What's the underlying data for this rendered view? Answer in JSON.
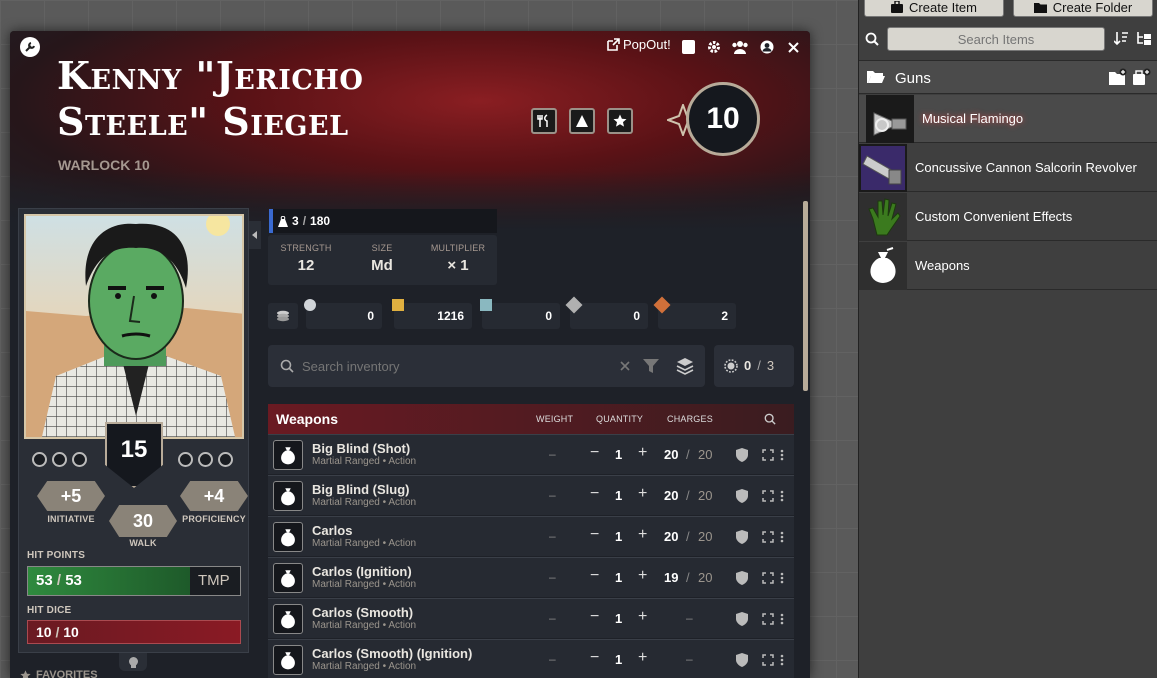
{
  "sheet": {
    "popout_label": "PopOut!",
    "character_name": "Kenny \"Jericho Steele\" Siegel",
    "class_level": "WARLOCK 10",
    "level": "10",
    "armor_class": "15",
    "initiative": {
      "value": "+5",
      "label": "INITIATIVE"
    },
    "proficiency": {
      "value": "+4",
      "label": "PROFICIENCY"
    },
    "walk": {
      "value": "30",
      "label": "WALK"
    },
    "hit_points": {
      "label": "HIT POINTS",
      "current": "53",
      "max": "53",
      "temp_label": "TMP"
    },
    "hit_dice": {
      "label": "HIT DICE",
      "current": "10",
      "max": "10"
    },
    "favorites_label": "FAVORITES",
    "encumbrance": {
      "current": "3",
      "max": "180",
      "fraction": 0.017
    },
    "stats": [
      {
        "label": "STRENGTH",
        "value": "12"
      },
      {
        "label": "SIZE",
        "value": "Md"
      },
      {
        "label": "MULTIPLIER",
        "value": "× 1"
      }
    ],
    "currency": [
      "0",
      "1216",
      "0",
      "0",
      "2"
    ],
    "search_placeholder": "Search inventory",
    "attunement": {
      "current": "0",
      "max": "3"
    },
    "weapons_header": {
      "title": "Weapons",
      "weight": "WEIGHT",
      "quantity": "QUANTITY",
      "charges": "CHARGES"
    },
    "weapons": [
      {
        "name": "Big Blind (Shot)",
        "sub": "Martial Ranged • Action",
        "weight": "–",
        "qty": "1",
        "charges": "20",
        "max": "20"
      },
      {
        "name": "Big Blind (Slug)",
        "sub": "Martial Ranged • Action",
        "weight": "–",
        "qty": "1",
        "charges": "20",
        "max": "20"
      },
      {
        "name": "Carlos",
        "sub": "Martial Ranged • Action",
        "weight": "–",
        "qty": "1",
        "charges": "20",
        "max": "20"
      },
      {
        "name": "Carlos (Ignition)",
        "sub": "Martial Ranged • Action",
        "weight": "–",
        "qty": "1",
        "charges": "19",
        "max": "20"
      },
      {
        "name": "Carlos (Smooth)",
        "sub": "Martial Ranged • Action",
        "weight": "–",
        "qty": "1",
        "charges": "–",
        "max": ""
      },
      {
        "name": "Carlos (Smooth) (Ignition)",
        "sub": "Martial Ranged • Action",
        "weight": "–",
        "qty": "1",
        "charges": "–",
        "max": ""
      }
    ]
  },
  "items_panel": {
    "create_item": "Create Item",
    "create_folder": "Create Folder",
    "search_placeholder": "Search Items",
    "folder": "Guns",
    "items": [
      {
        "name": "Musical Flamingo",
        "icon": "trumpet-icon"
      },
      {
        "name": "Concussive Cannon Salcorin Revolver",
        "icon": "cannon-icon"
      },
      {
        "name": "Custom Convenient Effects",
        "icon": "hand-icon"
      },
      {
        "name": "Weapons",
        "icon": "sack-icon"
      }
    ]
  }
}
